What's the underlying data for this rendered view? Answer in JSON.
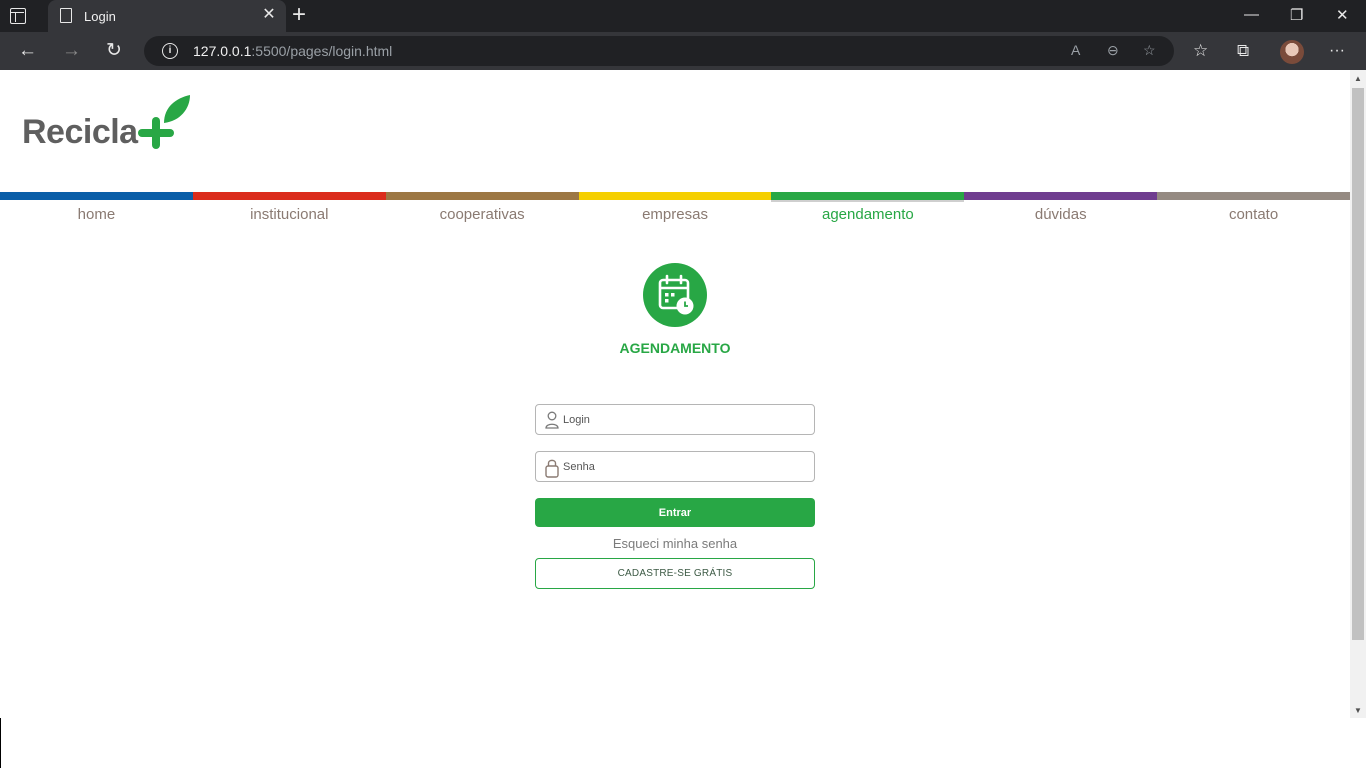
{
  "browser": {
    "tab_title": "Login",
    "url_host": "127.0.0.1",
    "url_rest": ":5500/pages/login.html",
    "info_glyph": "i",
    "new_tab_glyph": "+",
    "close_tab_glyph": "✕",
    "minimize_glyph": "—",
    "restore_glyph": "❐",
    "close_window_glyph": "✕",
    "back_glyph": "←",
    "forward_glyph": "→",
    "reload_glyph": "↻",
    "read_aloud_glyph": "A",
    "zoom_glyph": "⊖",
    "add_favorite_glyph": "☆",
    "favorites_glyph": "☆",
    "collections_glyph": "⧉",
    "more_glyph": "···"
  },
  "brand": {
    "logo_text": "Recicla",
    "green": "#28a745",
    "text_gray": "#5f5f5f"
  },
  "nav": {
    "items": [
      {
        "label": "home",
        "color": "#0a5ea8"
      },
      {
        "label": "institucional",
        "color": "#db2c1c"
      },
      {
        "label": "cooperativas",
        "color": "#9c7744"
      },
      {
        "label": "empresas",
        "color": "#f5cf00"
      },
      {
        "label": "agendamento",
        "color": "#28a745",
        "active": true
      },
      {
        "label": "dúvidas",
        "color": "#6f3d8f"
      },
      {
        "label": "contato",
        "color": "#958a82"
      }
    ]
  },
  "hero": {
    "icon": "calendar-clock-icon",
    "title": "AGENDAMENTO"
  },
  "form": {
    "login_placeholder": "Login",
    "password_placeholder": "Senha",
    "submit_label": "Entrar",
    "forgot_label": "Esqueci minha senha",
    "signup_label": "CADASTRE-SE GRÁTIS"
  }
}
